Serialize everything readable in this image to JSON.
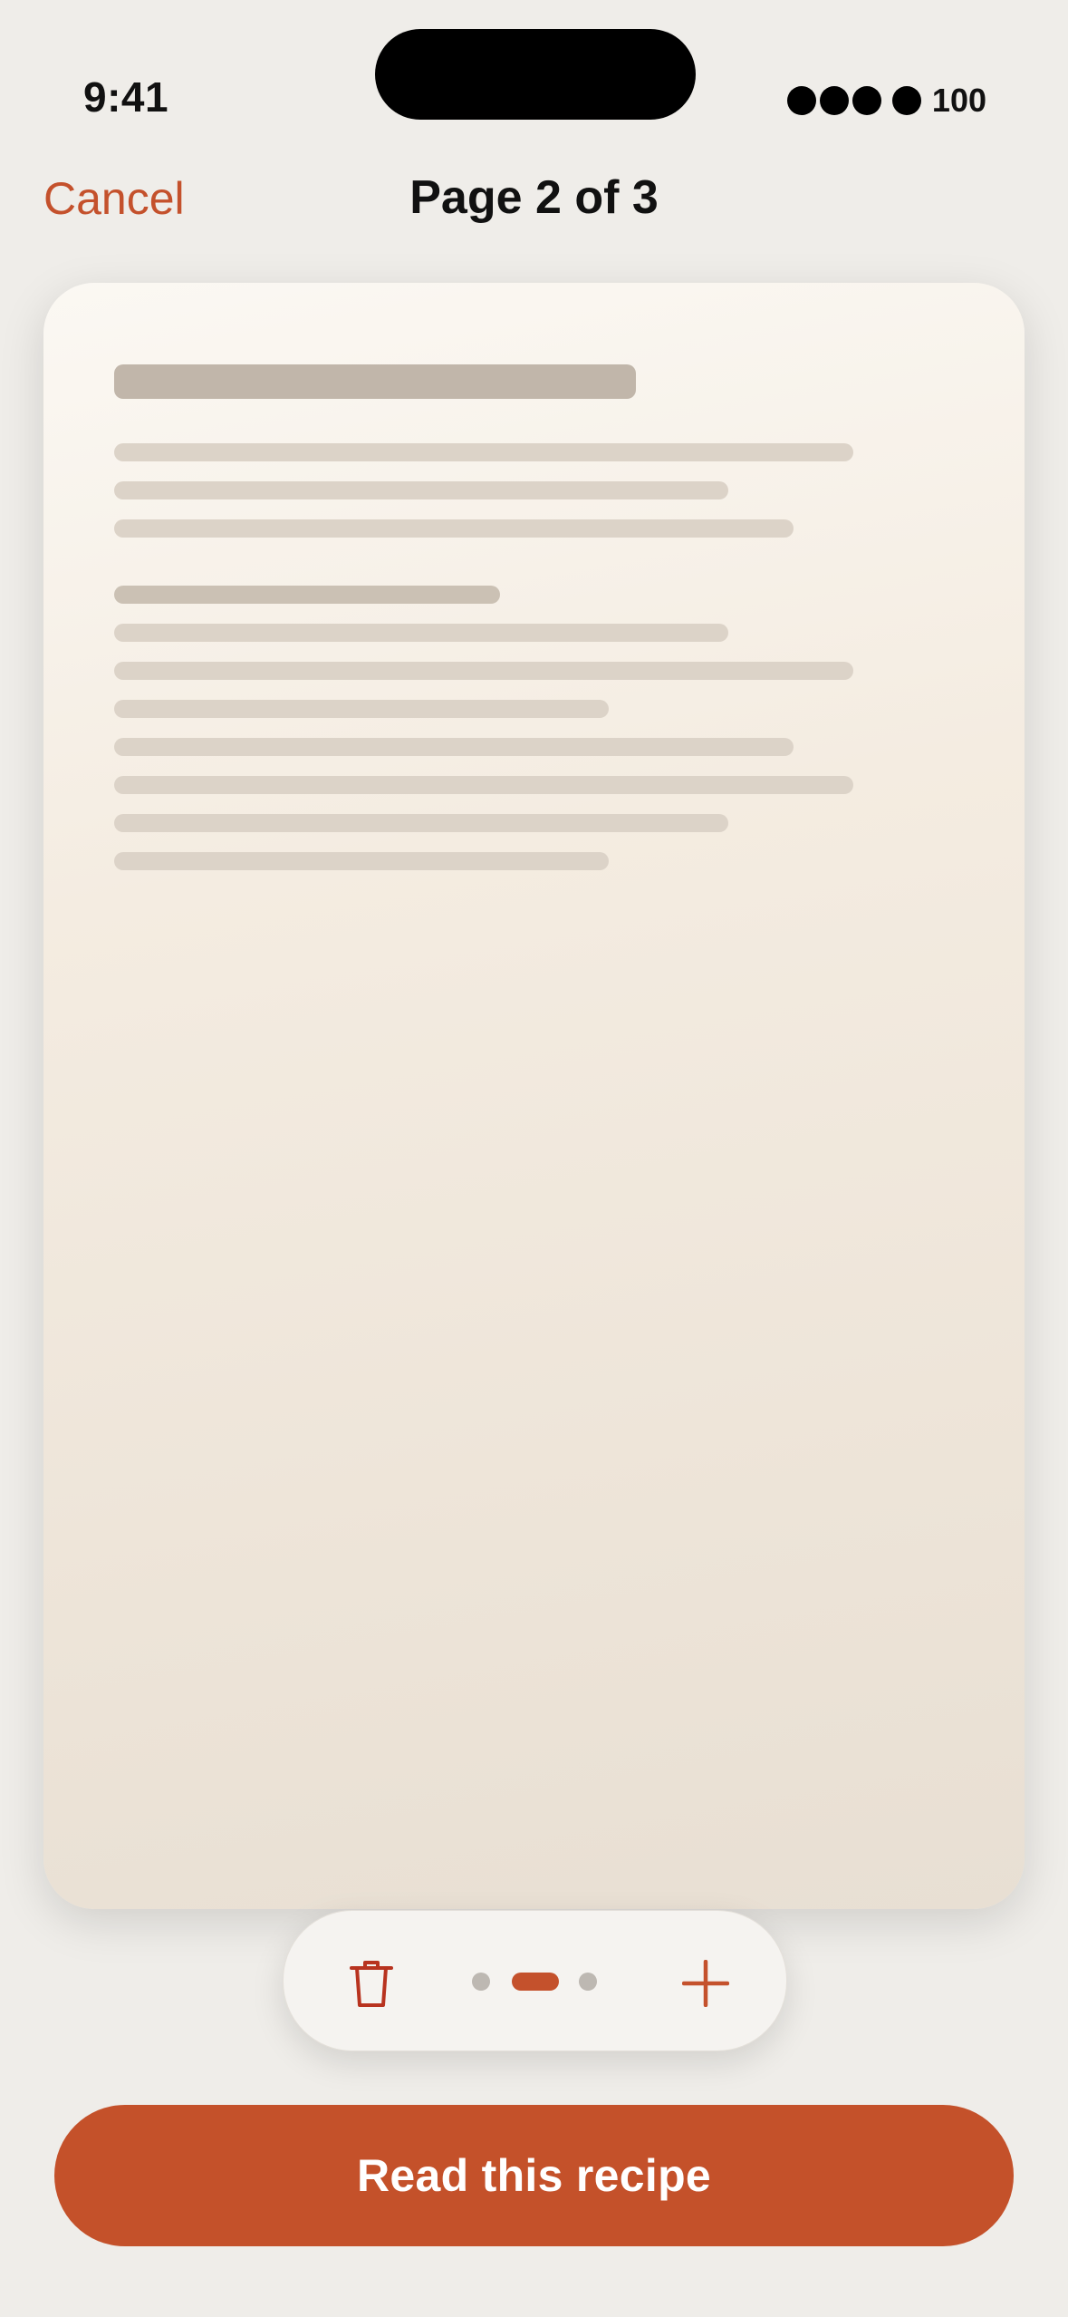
{
  "status_bar": {
    "time": "9:41",
    "battery": "100"
  },
  "nav": {
    "cancel_label": "Cancel",
    "title": "Page 2 of 3"
  },
  "page_control": {
    "current_page": 2,
    "total_pages": 3
  },
  "primary_action": {
    "label": "Read this recipe"
  },
  "icons": {
    "delete": "trash-icon",
    "add": "plus-icon"
  },
  "colors": {
    "accent": "#c4512c",
    "background": "#efede9",
    "card": "#f4ece1"
  }
}
